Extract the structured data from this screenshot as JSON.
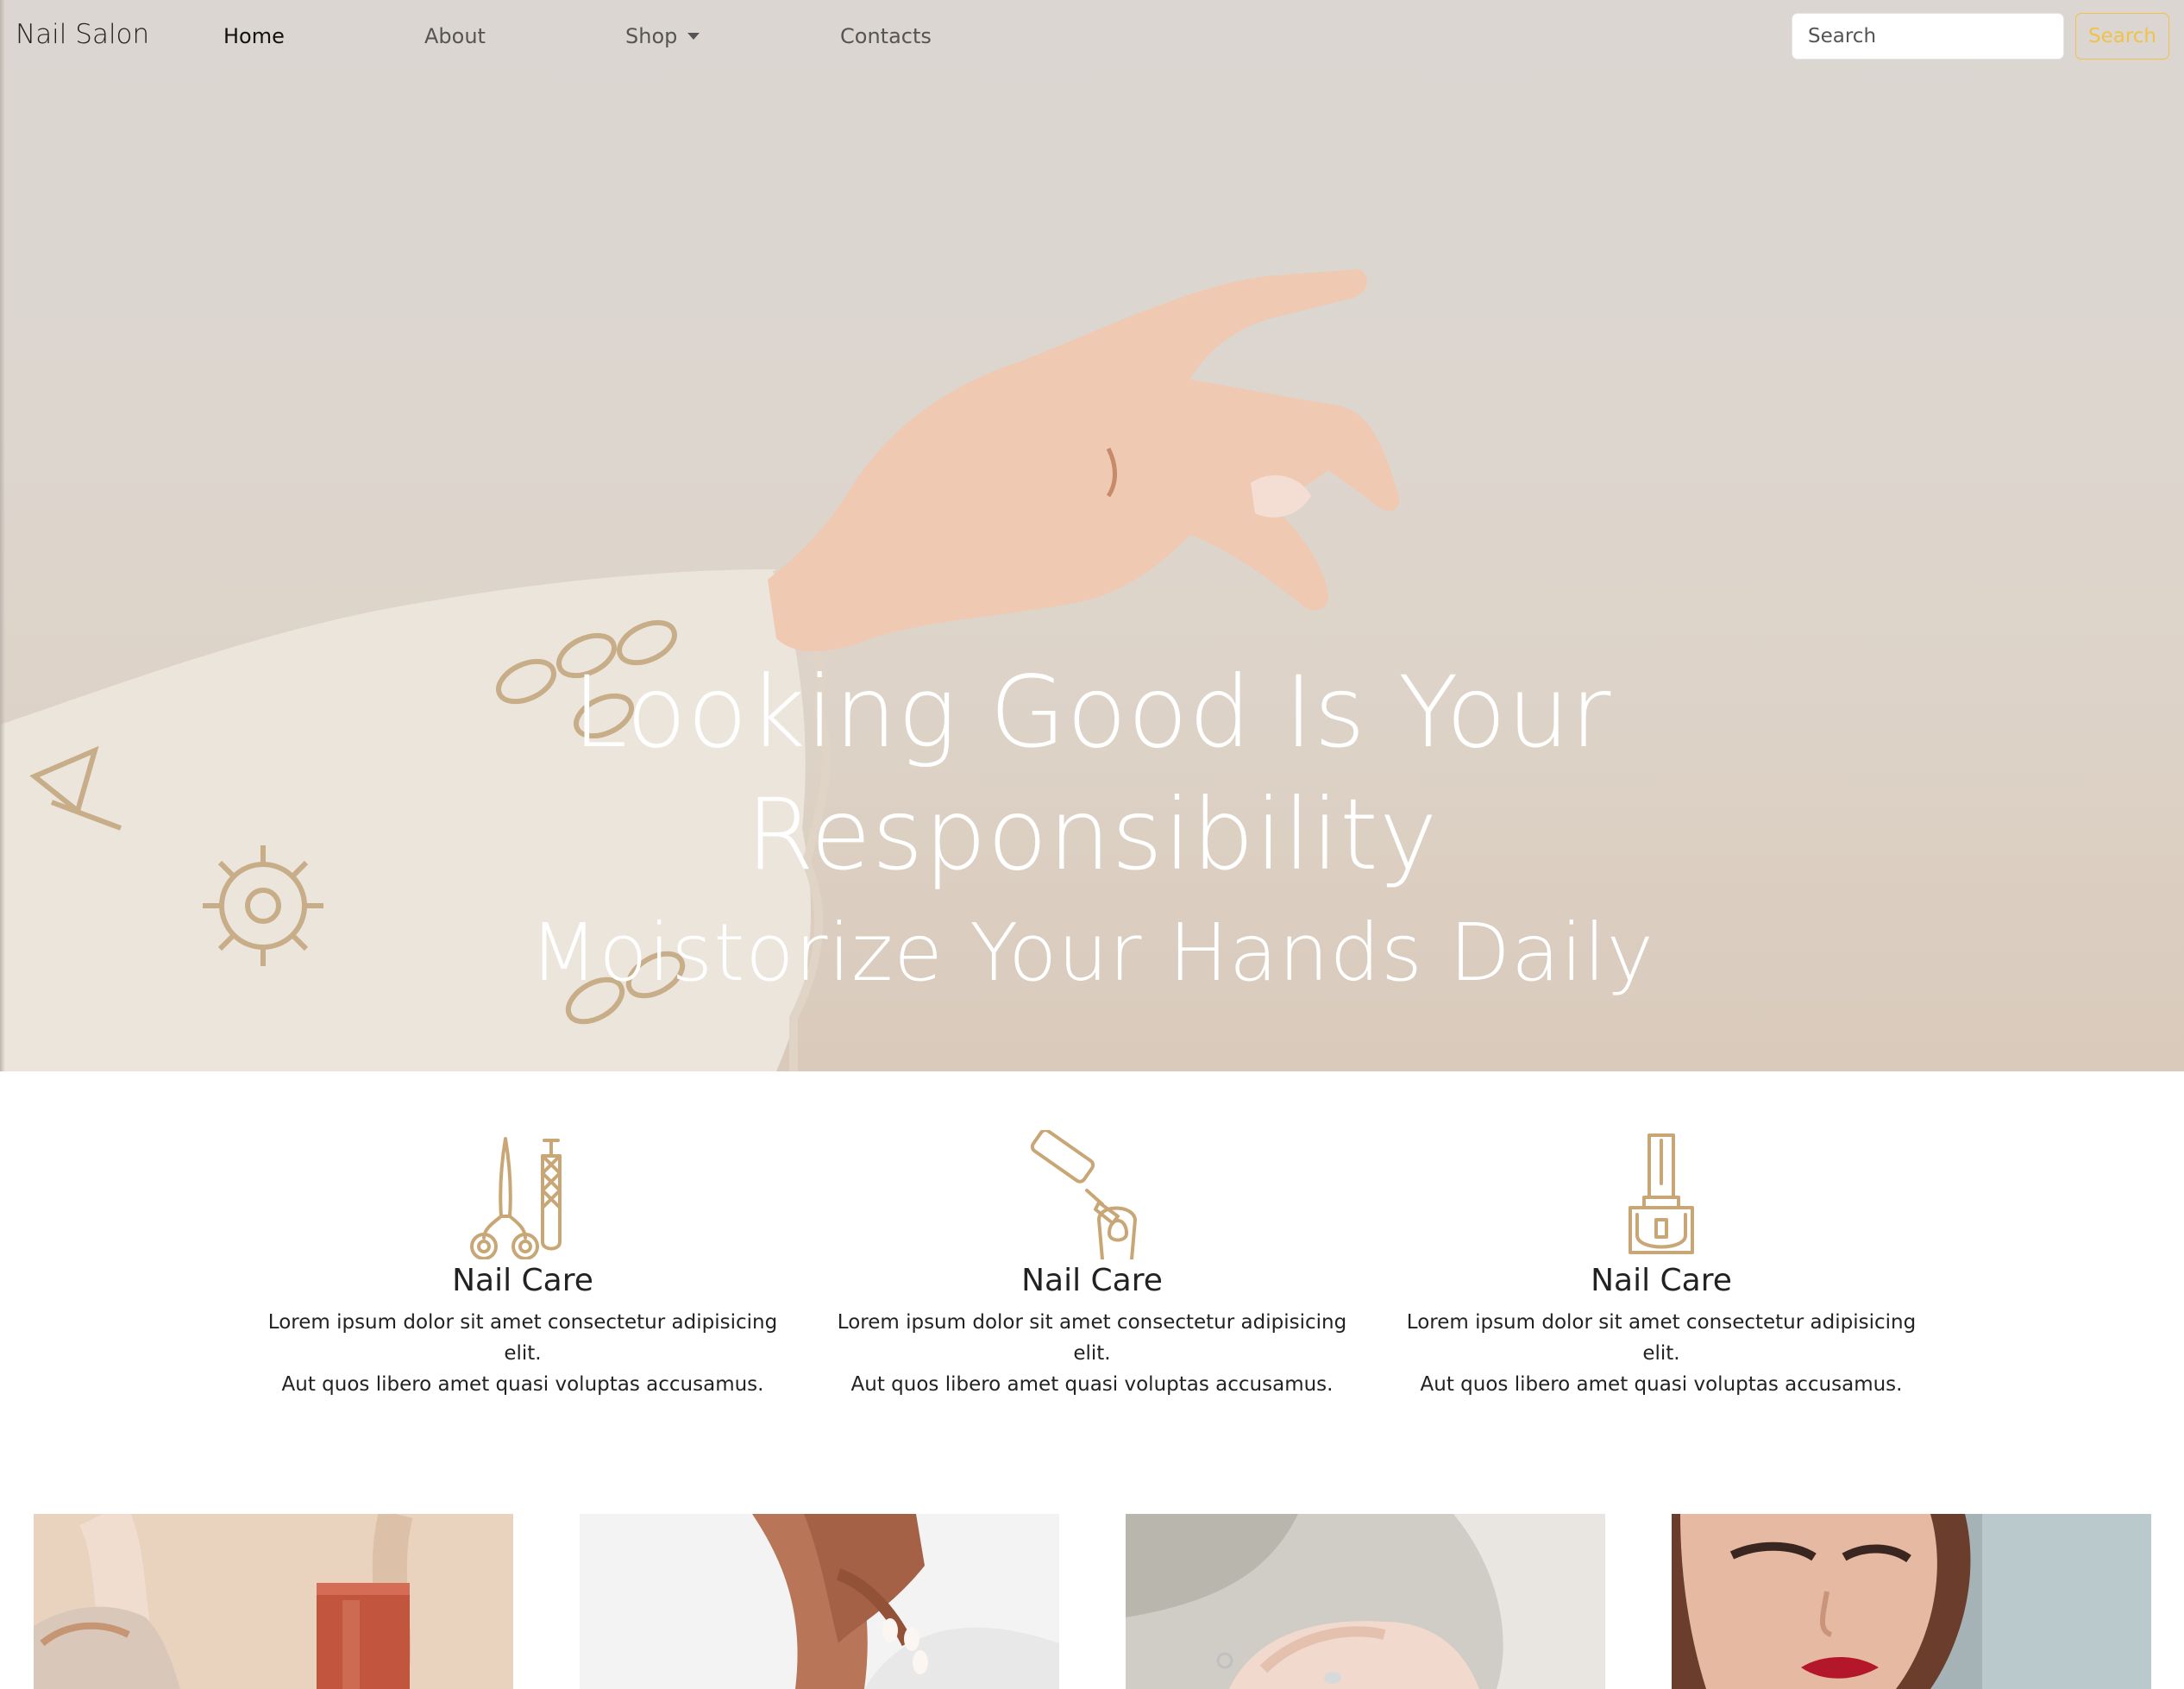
{
  "brand": "Nail Salon",
  "nav": {
    "home": "Home",
    "about": "About",
    "shop": "Shop",
    "contacts": "Contacts"
  },
  "search": {
    "placeholder": "Search",
    "button_label": "Search"
  },
  "hero": {
    "title": "Looking Good Is Your Responsibility",
    "subtitle": "Moistorize Your Hands Daily"
  },
  "features": [
    {
      "icon": "scissors-nail-file-icon",
      "title": "Nail Care",
      "text_line1": "Lorem ipsum dolor sit amet consectetur adipisicing elit.",
      "text_line2": "Aut quos libero amet quasi voluptas accusamus."
    },
    {
      "icon": "nail-polish-brush-icon",
      "title": "Nail Care",
      "text_line1": "Lorem ipsum dolor sit amet consectetur adipisicing elit.",
      "text_line2": "Aut quos libero amet quasi voluptas accusamus."
    },
    {
      "icon": "nail-polish-bottle-icon",
      "title": "Nail Care",
      "text_line1": "Lorem ipsum dolor sit amet consectetur adipisicing elit.",
      "text_line2": "Aut quos libero amet quasi voluptas accusamus."
    }
  ],
  "colors": {
    "accent": "#f0c24a",
    "icon_gold": "#c9a676",
    "hero_text": "#ffffff"
  }
}
